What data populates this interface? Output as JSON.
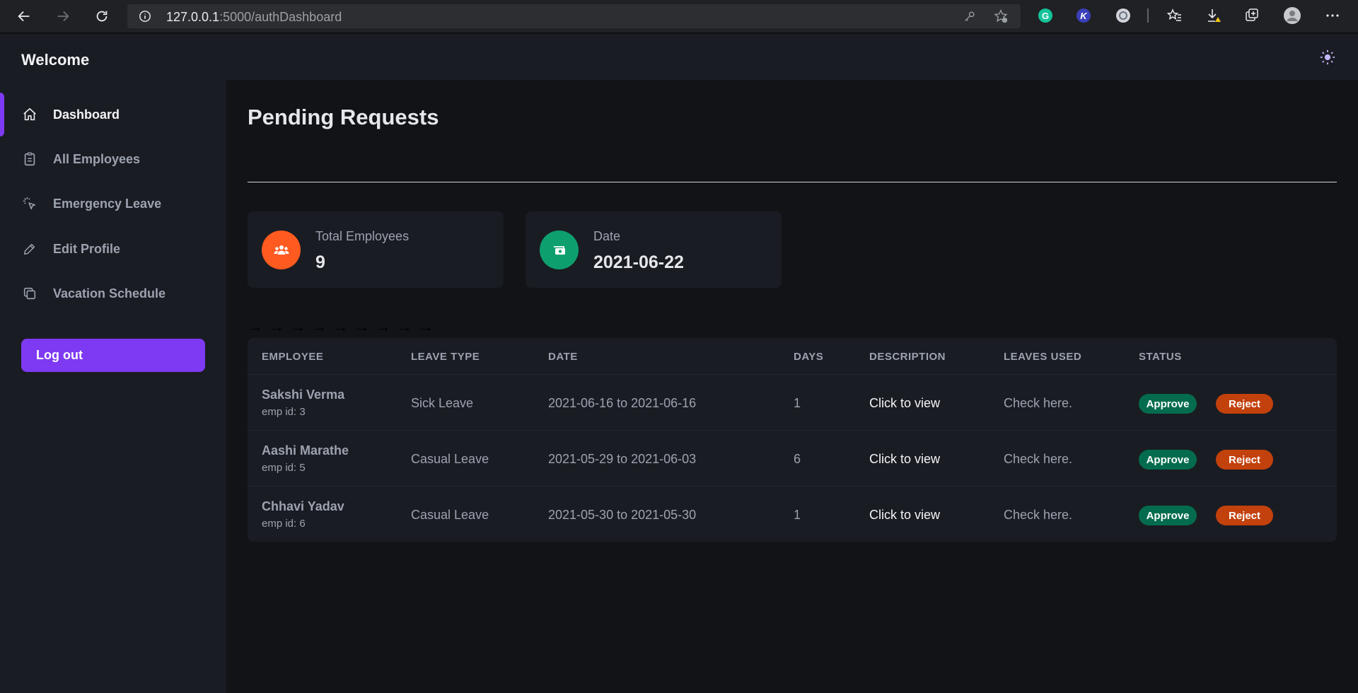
{
  "browser": {
    "url_host": "127.0.0.1",
    "url_path": ":5000/authDashboard"
  },
  "header": {
    "title": "Welcome",
    "theme_icon": "sun-icon"
  },
  "sidebar": {
    "items": [
      {
        "label": "Dashboard",
        "icon": "home-icon",
        "active": true
      },
      {
        "label": "All Employees",
        "icon": "clipboard-icon",
        "active": false
      },
      {
        "label": "Emergency Leave",
        "icon": "cursor-click-icon",
        "active": false
      },
      {
        "label": "Edit Profile",
        "icon": "pencil-icon",
        "active": false
      },
      {
        "label": "Vacation Schedule",
        "icon": "copy-icon",
        "active": false
      }
    ],
    "logout_label": "Log out"
  },
  "main": {
    "title": "Pending Requests",
    "arrows": "→ → → → → → → → →",
    "cards": [
      {
        "title": "Total Employees",
        "value": "9",
        "icon": "users-icon",
        "color": "#ff5a1f"
      },
      {
        "title": "Date",
        "value": "2021-06-22",
        "icon": "cash-icon",
        "color": "#0e9f6e"
      }
    ],
    "table": {
      "headers": [
        "EMPLOYEE",
        "LEAVE TYPE",
        "DATE",
        "DAYS",
        "DESCRIPTION",
        "LEAVES USED",
        "STATUS"
      ],
      "rows": [
        {
          "name": "Sakshi Verma",
          "emp_id": "emp id: 3",
          "leave_type": "Sick Leave",
          "date": "2021-06-16 to 2021-06-16",
          "days": "1",
          "description": "Click to view",
          "leaves_used": "Check here.",
          "approve": "Approve",
          "reject": "Reject"
        },
        {
          "name": "Aashi Marathe",
          "emp_id": "emp id: 5",
          "leave_type": "Casual Leave",
          "date": "2021-05-29 to 2021-06-03",
          "days": "6",
          "description": "Click to view",
          "leaves_used": "Check here.",
          "approve": "Approve",
          "reject": "Reject"
        },
        {
          "name": "Chhavi Yadav",
          "emp_id": "emp id: 6",
          "leave_type": "Casual Leave",
          "date": "2021-05-30 to 2021-05-30",
          "days": "1",
          "description": "Click to view",
          "leaves_used": "Check here.",
          "approve": "Approve",
          "reject": "Reject"
        }
      ]
    }
  },
  "colors": {
    "accent": "#7e3af2",
    "approve": "#046c4e",
    "reject": "#c2410c"
  }
}
